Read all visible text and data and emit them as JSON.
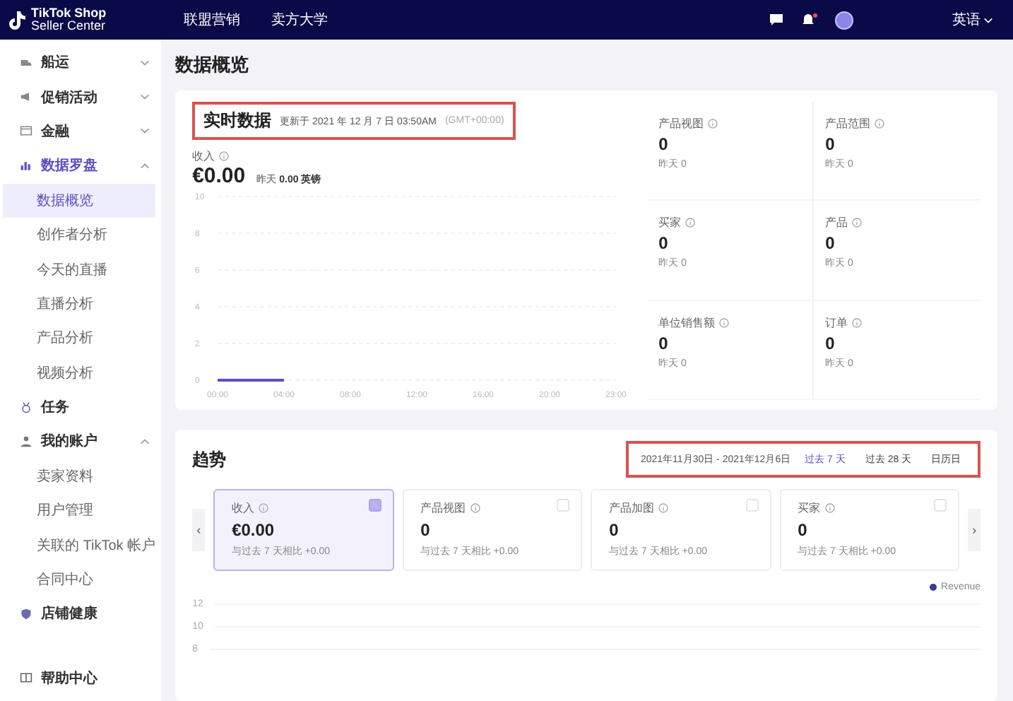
{
  "topbar": {
    "logo_line1": "TikTok Shop",
    "logo_line2": "Seller Center",
    "nav": [
      {
        "label": "联盟营销"
      },
      {
        "label": "卖方大学"
      }
    ],
    "notifications": true,
    "language": "英语"
  },
  "sidebar": {
    "items": [
      {
        "label": "船运",
        "expanded": false,
        "selected": false
      },
      {
        "label": "促销活动",
        "expanded": false,
        "selected": false
      },
      {
        "label": "金融",
        "expanded": false,
        "selected": false
      },
      {
        "label": "数据罗盘",
        "expanded": true,
        "selected": true,
        "children": [
          {
            "label": "数据概览",
            "selected": true
          },
          {
            "label": "创作者分析",
            "selected": false
          },
          {
            "label": "今天的直播",
            "selected": false
          },
          {
            "label": "直播分析",
            "selected": false
          },
          {
            "label": "产品分析",
            "selected": false
          },
          {
            "label": "视频分析",
            "selected": false
          }
        ]
      },
      {
        "label": "任务",
        "selected": false
      },
      {
        "label": "我的账户",
        "expanded": true,
        "selected": false,
        "children": [
          {
            "label": "卖家资料",
            "selected": false
          },
          {
            "label": "用户管理",
            "selected": false
          },
          {
            "label": "关联的 TikTok 帐户",
            "selected": false
          },
          {
            "label": "合同中心",
            "selected": false
          }
        ]
      },
      {
        "label": "店铺健康",
        "selected": false
      },
      {
        "label": "帮助中心",
        "selected": false
      }
    ]
  },
  "page_title": "数据概览",
  "realtime": {
    "title": "实时数据",
    "updated": "更新于 2021 年 12 月 7 日 03:50AM",
    "timezone": "(GMT+00:00)",
    "annotated": true,
    "revenue": {
      "label": "收入",
      "value": "€0.00",
      "yesterday_label": "昨天",
      "yesterday_value": "0.00 英镑"
    },
    "chart_data": {
      "type": "line",
      "x": [
        "00:00",
        "04:00",
        "08:00",
        "12:00",
        "16:00",
        "20:00",
        "23:00"
      ],
      "grid": true,
      "series": [
        {
          "color": "#5b4fc4",
          "values": [
            0,
            0,
            null,
            null,
            null,
            null,
            null
          ]
        }
      ],
      "ylim": [
        0,
        10
      ],
      "yticks": [
        0,
        2,
        4,
        6,
        8,
        10
      ]
    },
    "metrics": [
      {
        "label": "产品视图",
        "value": "0",
        "sub": "昨天 0"
      },
      {
        "label": "产品范围",
        "value": "0",
        "sub": "昨天 0"
      },
      {
        "label": "买家",
        "value": "0",
        "sub": "昨天 0"
      },
      {
        "label": "产品",
        "value": "0",
        "sub": "昨天 0"
      },
      {
        "label": "单位销售额",
        "value": "0",
        "sub": "昨天 0"
      },
      {
        "label": "订单",
        "value": "0",
        "sub": "昨天 0"
      }
    ]
  },
  "trend": {
    "title": "趋势",
    "date_range": "2021年11月30日 - 2021年12月6日",
    "annotated": true,
    "ranges": [
      {
        "label": "过去 7 天",
        "selected": true
      },
      {
        "label": "过去 28 天",
        "selected": false
      },
      {
        "label": "日历日",
        "selected": false
      }
    ],
    "cards": [
      {
        "label": "收入",
        "value": "€0.00",
        "compare": "与过去 7 天相比 +0.00",
        "selected": true
      },
      {
        "label": "产品视图",
        "value": "0",
        "compare": "与过去 7 天相比 +0.00",
        "selected": false
      },
      {
        "label": "产品加图",
        "value": "0",
        "compare": "与过去 7 天相比 +0.00",
        "selected": false
      },
      {
        "label": "买家",
        "value": "0",
        "compare": "与过去 7 天相比 +0.00",
        "selected": false
      }
    ],
    "prev": "‹",
    "next": "›",
    "legend": {
      "label": "Revenue",
      "color": "#3b3a8c"
    },
    "y_labels": [
      "12",
      "10",
      "8"
    ]
  }
}
